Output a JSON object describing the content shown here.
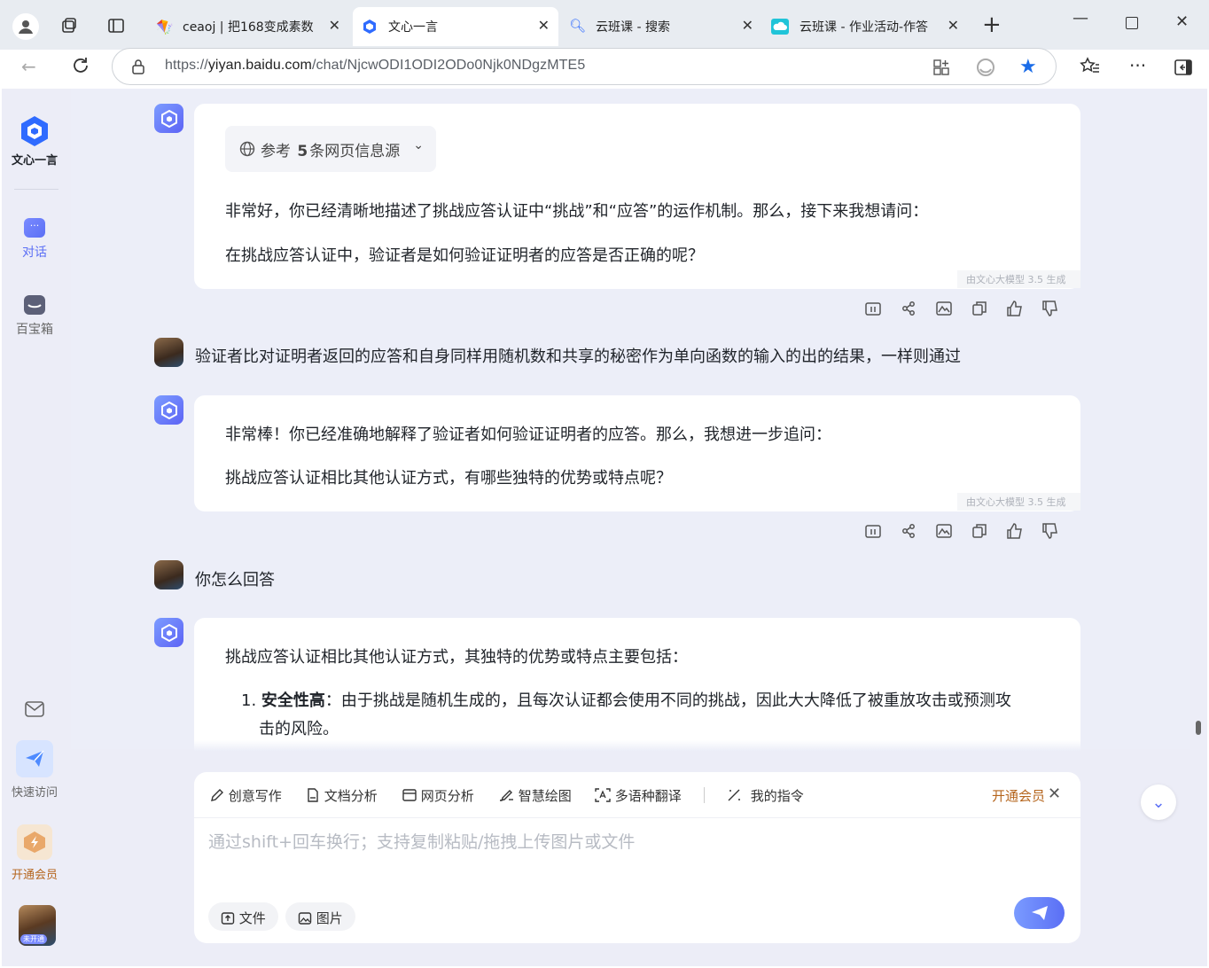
{
  "browser": {
    "tabs": [
      {
        "title": "ceaoj | 把168变成素数",
        "active": false
      },
      {
        "title": "文心一言",
        "active": true
      },
      {
        "title": "云班课 - 搜索",
        "active": false
      },
      {
        "title": "云班课 - 作业活动-作答",
        "active": false
      }
    ],
    "url_prefix": "https://",
    "url_host": "yiyan.baidu.com",
    "url_path": "/chat/NjcwODI1ODI2ODo0Njk0NDgzMTE5"
  },
  "sidebar": {
    "logo_text": "文心一言",
    "items": [
      {
        "label": "对话",
        "icon": "chat-bubble-icon"
      },
      {
        "label": "百宝箱",
        "icon": "treasure-box-icon"
      }
    ],
    "bottom": [
      {
        "label": "",
        "icon": "mail-icon"
      },
      {
        "label": "快速访问",
        "icon": "paper-plane-icon"
      },
      {
        "label": "开通会员",
        "icon": "vip-badge-icon"
      }
    ],
    "avatar_badge": "未开通"
  },
  "chat": {
    "reference": {
      "label_pre": "参考",
      "count": "5",
      "label_post": "条网页信息源"
    },
    "messages": [
      {
        "role": "bot",
        "lines": [
          "非常好，你已经清晰地描述了挑战应答认证中“挑战”和“应答”的运作机制。那么，接下来我想请问：",
          "在挑战应答认证中，验证者是如何验证证明者的应答是否正确的呢？"
        ],
        "generated_by": "由文心大模型 3.5 生成"
      },
      {
        "role": "user",
        "text": "验证者比对证明者返回的应答和自身同样用随机数和共享的秘密作为单向函数的输入的出的结果，一样则通过"
      },
      {
        "role": "bot",
        "lines": [
          "非常棒！你已经准确地解释了验证者如何验证证明者的应答。那么，我想进一步追问：",
          "挑战应答认证相比其他认证方式，有哪些独特的优势或特点呢？"
        ],
        "generated_by": "由文心大模型 3.5 生成"
      },
      {
        "role": "user",
        "text": "你怎么回答"
      },
      {
        "role": "bot",
        "intro": "挑战应答认证相比其他认证方式，其独特的优势或特点主要包括：",
        "list": [
          {
            "num": "1.",
            "title": "安全性高",
            "text_line1": "：由于挑战是随机生成的，且每次认证都会使用不同的挑战，因此大大降低了被重放攻击或预测攻",
            "text_line2": "击的风险。"
          }
        ]
      }
    ]
  },
  "input": {
    "tools": [
      "创意写作",
      "文档分析",
      "网页分析",
      "智慧绘图",
      "多语种翻译",
      "我的指令"
    ],
    "vip_label": "开通会员",
    "placeholder": "通过shift+回车换行；支持复制粘贴/拖拽上传图片或文件",
    "chips": [
      "文件",
      "图片"
    ]
  },
  "colors": {
    "accent": "#5b6ff5",
    "page_bg": "#ecedf7",
    "vip": "#b5651d"
  }
}
